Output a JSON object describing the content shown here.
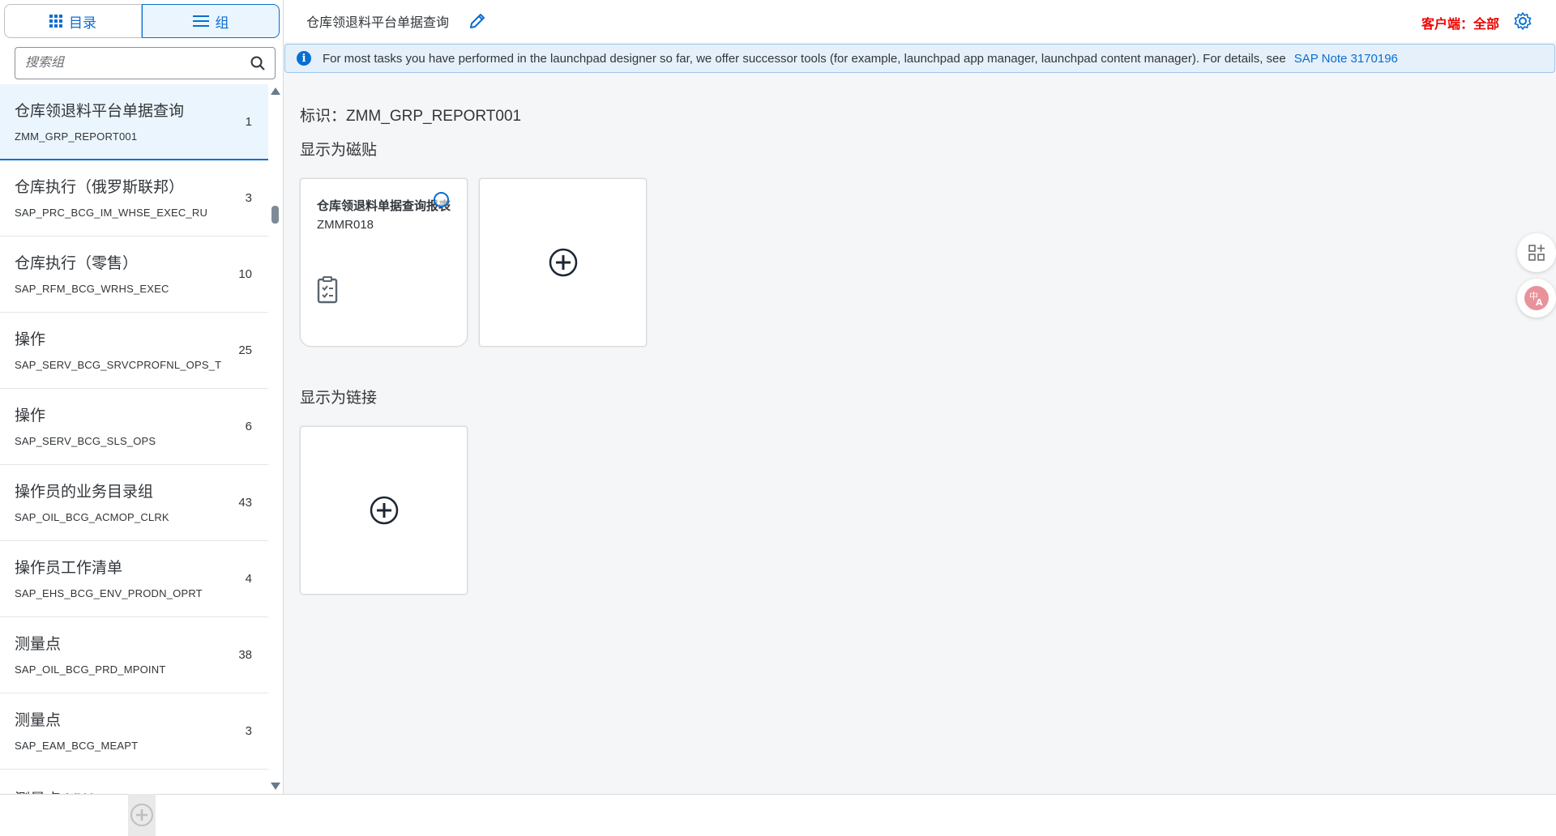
{
  "sidebar": {
    "tabs": {
      "catalog_label": "目录",
      "groups_label": "组"
    },
    "search": {
      "placeholder": "搜索组"
    },
    "items": [
      {
        "title": "仓库领退料平台单据查询",
        "id": "ZMM_GRP_REPORT001",
        "count": "1"
      },
      {
        "title": "仓库执行（俄罗斯联邦）",
        "id": "SAP_PRC_BCG_IM_WHSE_EXEC_RU",
        "count": "3"
      },
      {
        "title": "仓库执行（零售）",
        "id": "SAP_RFM_BCG_WRHS_EXEC",
        "count": "10"
      },
      {
        "title": "操作",
        "id": "SAP_SERV_BCG_SRVCPROFNL_OPS_T",
        "count": "25"
      },
      {
        "title": "操作",
        "id": "SAP_SERV_BCG_SLS_OPS",
        "count": "6"
      },
      {
        "title": "操作员的业务目录组",
        "id": "SAP_OIL_BCG_ACMOP_CLRK",
        "count": "43"
      },
      {
        "title": "操作员工作清单",
        "id": "SAP_EHS_BCG_ENV_PRODN_OPRT",
        "count": "4"
      },
      {
        "title": "测量点",
        "id": "SAP_OIL_BCG_PRD_MPOINT",
        "count": "38"
      },
      {
        "title": "测量点",
        "id": "SAP_EAM_BCG_MEAPT",
        "count": "3"
      },
      {
        "title": "测量点 MW",
        "id": "",
        "count": ""
      }
    ]
  },
  "header": {
    "title": "仓库领退料平台单据查询",
    "client_label": "客户端：全部"
  },
  "info": {
    "message": "For most tasks you have performed in the launchpad designer so far, we offer successor tools (for example, launchpad app manager, launchpad content manager). For details, see",
    "link": "SAP Note 3170196"
  },
  "main": {
    "id_line": "标识：ZMM_GRP_REPORT001",
    "tiles_section": "显示为磁贴",
    "links_section": "显示为链接",
    "tile": {
      "title": "仓库领退料单据查询报表",
      "subtitle": "ZMMR018"
    }
  },
  "colors": {
    "accent": "#0a6ed1",
    "client_red": "#ee0000",
    "selected_bg": "#ebf5fe"
  }
}
